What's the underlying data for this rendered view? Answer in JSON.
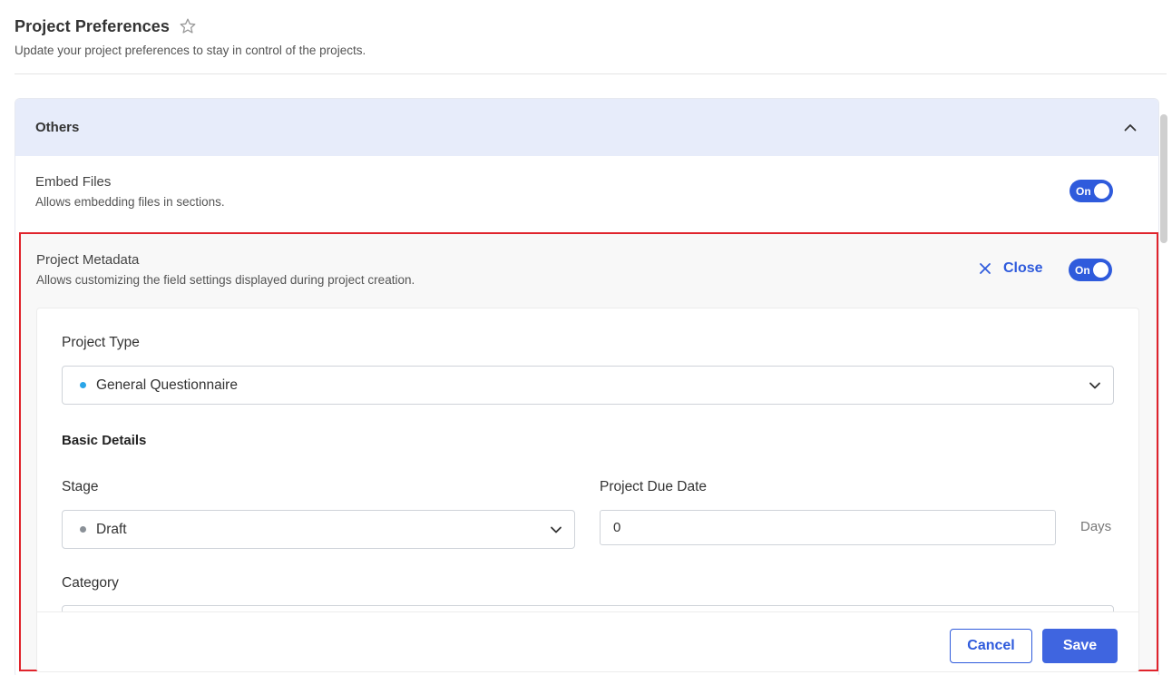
{
  "header": {
    "title": "Project Preferences",
    "subtitle": "Update your project preferences to stay in control of the projects."
  },
  "panel": {
    "label": "Others",
    "embed_files": {
      "title": "Embed Files",
      "description": "Allows embedding files in sections.",
      "toggle_label": "On"
    },
    "project_metadata": {
      "title": "Project Metadata",
      "description": "Allows customizing the field settings displayed during project creation.",
      "close_label": "Close",
      "toggle_label": "On"
    }
  },
  "form": {
    "project_type_label": "Project Type",
    "project_type_value": "General Questionnaire",
    "basic_details_label": "Basic Details",
    "stage_label": "Stage",
    "stage_value": "Draft",
    "due_date_label": "Project Due Date",
    "due_date_value": "0",
    "due_date_unit": "Days",
    "category_label": "Category",
    "cancel_label": "Cancel",
    "save_label": "Save"
  },
  "colors": {
    "accent": "#2f5bdc",
    "panel_header_bg": "#e7ecfa",
    "highlight_border": "#e0242c",
    "project_type_dot": "#2aa5e8",
    "stage_dot": "#8a9097"
  },
  "icons": {
    "favorite": "star-icon",
    "collapse": "chevron-up-icon",
    "close": "close-icon",
    "dropdown": "chevron-down-icon"
  }
}
